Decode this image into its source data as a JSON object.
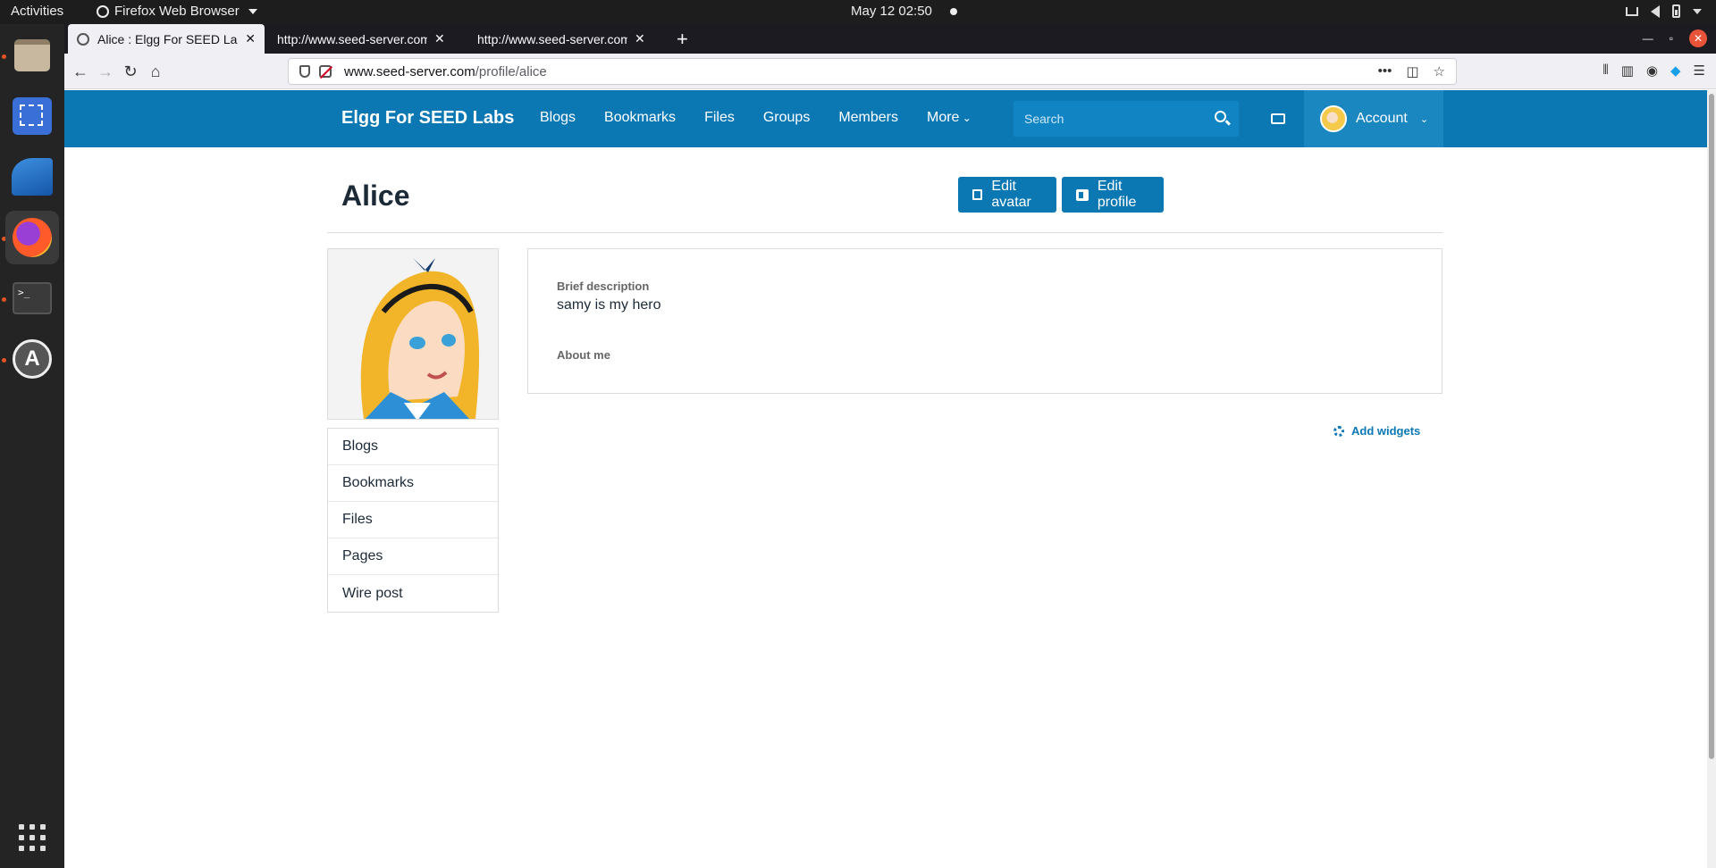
{
  "system": {
    "activities": "Activities",
    "app_name": "Firefox Web Browser",
    "clock": "May 12  02:50"
  },
  "browser": {
    "tabs": [
      {
        "title": "Alice : Elgg For SEED Labs",
        "active": true
      },
      {
        "title": "http://www.seed-server.com",
        "active": false
      },
      {
        "title": "http://www.seed-server.com",
        "active": false
      }
    ],
    "url_host": "www.seed-server.com",
    "url_path": "/profile/alice"
  },
  "site": {
    "name": "Elgg For SEED Labs",
    "nav": [
      "Blogs",
      "Bookmarks",
      "Files",
      "Groups",
      "Members",
      "More"
    ],
    "search_placeholder": "Search",
    "account_label": "Account",
    "brand_color": "#0b78b4"
  },
  "profile": {
    "name": "Alice",
    "edit_avatar": "Edit avatar",
    "edit_profile": "Edit profile",
    "owner_menu": [
      "Blogs",
      "Bookmarks",
      "Files",
      "Pages",
      "Wire post"
    ],
    "brief_description_label": "Brief description",
    "brief_description": "samy is my hero",
    "about_me_label": "About me",
    "add_widgets": "Add widgets"
  }
}
